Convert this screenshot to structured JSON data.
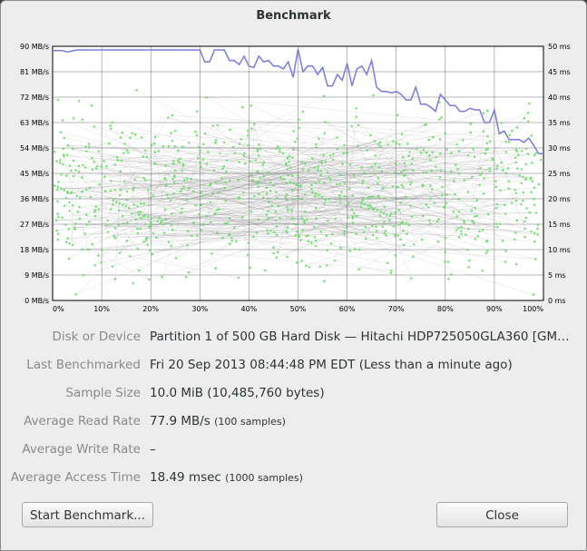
{
  "window": {
    "title": "Benchmark"
  },
  "chart_data": {
    "type": "line",
    "x_ticks": [
      "0%",
      "10%",
      "20%",
      "30%",
      "40%",
      "50%",
      "60%",
      "70%",
      "80%",
      "90%",
      "100%"
    ],
    "y_left_ticks": [
      "0 MB/s",
      "9 MB/s",
      "18 MB/s",
      "27 MB/s",
      "36 MB/s",
      "45 MB/s",
      "54 MB/s",
      "63 MB/s",
      "72 MB/s",
      "81 MB/s",
      "90 MB/s"
    ],
    "y_right_ticks": [
      "0 ms",
      "5 ms",
      "10 ms",
      "15 ms",
      "20 ms",
      "25 ms",
      "30 ms",
      "35 ms",
      "40 ms",
      "45 ms",
      "50 ms"
    ],
    "xlim": [
      0,
      100
    ],
    "ylim_left": [
      0,
      90
    ],
    "ylim_right": [
      0,
      50
    ],
    "grid": true,
    "series": [
      {
        "axis": "left",
        "color": "#7a7ae0",
        "x": [
          0,
          2,
          3,
          5,
          10,
          15,
          20,
          25,
          30,
          31,
          32,
          33,
          34,
          35,
          36,
          37,
          38,
          39,
          40,
          41,
          42,
          43,
          44,
          45,
          46,
          47,
          48,
          49,
          50,
          51,
          52,
          53,
          54,
          55,
          56,
          57,
          58,
          59,
          60,
          61,
          62,
          63,
          64,
          65,
          66,
          67,
          68,
          69,
          70,
          71,
          72,
          73,
          74,
          75,
          76,
          77,
          78,
          79,
          80,
          81,
          82,
          83,
          84,
          85,
          86,
          87,
          88,
          89,
          90,
          91,
          92,
          93,
          94,
          95,
          96,
          97,
          98,
          99,
          100
        ],
        "values": [
          88.5,
          88.5,
          88,
          88.7,
          88.7,
          88.7,
          88.7,
          88.7,
          88.7,
          84.5,
          84.5,
          88.7,
          88.7,
          88.7,
          85,
          85,
          83.5,
          86.5,
          83,
          82.5,
          86.5,
          84.5,
          85,
          83,
          83,
          82,
          84.5,
          79,
          89,
          81,
          83,
          83,
          80,
          82.5,
          76,
          76,
          80,
          78,
          84,
          76,
          82,
          83,
          80,
          85,
          75.5,
          74,
          74,
          73.5,
          74,
          73,
          71,
          71,
          75.5,
          69.5,
          69.5,
          68.5,
          67,
          73,
          71,
          69,
          69,
          67,
          67,
          68,
          67.5,
          67.5,
          63,
          63,
          67.5,
          59,
          60,
          57,
          57,
          57,
          56,
          57.5,
          55,
          52,
          52
        ]
      }
    ]
  },
  "details": [
    {
      "label": "Disk or Device",
      "value": "Partition 1 of 500 GB Hard Disk — Hitachi HDP725050GLA360 [GM…",
      "note": ""
    },
    {
      "label": "Last Benchmarked",
      "value": "Fri 20 Sep 2013 08:44:48 PM EDT (Less than a minute ago)",
      "note": ""
    },
    {
      "label": "Sample Size",
      "value": "10.0 MiB (10,485,760 bytes)",
      "note": ""
    },
    {
      "label": "Average Read Rate",
      "value": "77.9 MB/s",
      "note": "(100 samples)"
    },
    {
      "label": "Average Write Rate",
      "value": "–",
      "note": ""
    },
    {
      "label": "Average Access Time",
      "value": "18.49 msec",
      "note": "(1000 samples)"
    }
  ],
  "buttons": {
    "start": "Start Benchmark...",
    "close": "Close"
  }
}
